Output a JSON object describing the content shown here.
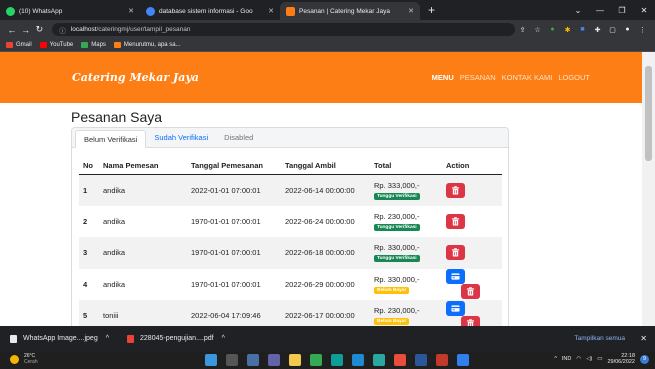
{
  "browser": {
    "tabs": [
      {
        "title": "(10) WhatsApp",
        "icon": "whatsapp-icon",
        "color": "#25d366"
      },
      {
        "title": "database sistem informasi - Goo",
        "icon": "google-search-icon",
        "color": "#4285f4"
      },
      {
        "title": "Pesanan | Catering Mekar Jaya",
        "icon": "site-icon",
        "color": "#fd7e14"
      }
    ],
    "new_tab": "+",
    "url_host": "localhost",
    "url_path": "/cateringmj/user/tampil_pesanan",
    "bookmarks": [
      {
        "label": "Gmail",
        "icon": "gmail-icon",
        "color": "#ea4335"
      },
      {
        "label": "YouTube",
        "icon": "youtube-icon",
        "color": "#ff0000"
      },
      {
        "label": "Maps",
        "icon": "maps-icon",
        "color": "#34a853"
      },
      {
        "label": "Menurutmu, apa sa...",
        "icon": "bookmark-site-icon",
        "color": "#fd7e14"
      }
    ]
  },
  "site": {
    "brand": "Catering Mekar Jaya",
    "menu": [
      "MENU",
      "PESANAN",
      "KONTAK KAMI",
      "LOGOUT"
    ],
    "accent": "#fd7e14"
  },
  "page": {
    "title": "Pesanan Saya",
    "tabs": [
      "Belum Verifikasi",
      "Sudah Verifikasi",
      "Disabled"
    ],
    "table": {
      "headers": [
        "No",
        "Nama Pemesan",
        "Tanggal Pemesanan",
        "Tanggal Ambil",
        "Total",
        "Action"
      ],
      "rows": [
        {
          "no": "1",
          "name": "andika",
          "order_date": "2022-01-01 07:00:01",
          "pickup_date": "2022-06-14 00:00:00",
          "total": "Rp. 333,000,-",
          "status": "Tunggu Verifikasi"
        },
        {
          "no": "2",
          "name": "andika",
          "order_date": "1970-01-01 07:00:01",
          "pickup_date": "2022-06-24 00:00:00",
          "total": "Rp. 230,000,-",
          "status": "Tunggu Verifikasi"
        },
        {
          "no": "3",
          "name": "andika",
          "order_date": "1970-01-01 07:00:01",
          "pickup_date": "2022-06-18 00:00:00",
          "total": "Rp. 330,000,-",
          "status": "Tunggu Verifikasi"
        },
        {
          "no": "4",
          "name": "andika",
          "order_date": "1970-01-01 07:00:01",
          "pickup_date": "2022-06-29 00:00:00",
          "total": "Rp. 330,000,-",
          "status": "Belum Bayar"
        },
        {
          "no": "5",
          "name": "toniii",
          "order_date": "2022-06-04 17:09:46",
          "pickup_date": "2022-06-17 00:00:00",
          "total": "Rp. 230,000,-",
          "status": "Belum Bayar"
        }
      ]
    }
  },
  "downloads": {
    "items": [
      "WhatsApp Image....jpeg",
      "228045-pengujian....pdf"
    ],
    "show_all": "Tampilkan semua"
  },
  "taskbar": {
    "temperature": "26°C",
    "weather": "Cerah",
    "lang": "IND",
    "time": "22:18",
    "date": "29/06/2022",
    "notifications": "9"
  }
}
